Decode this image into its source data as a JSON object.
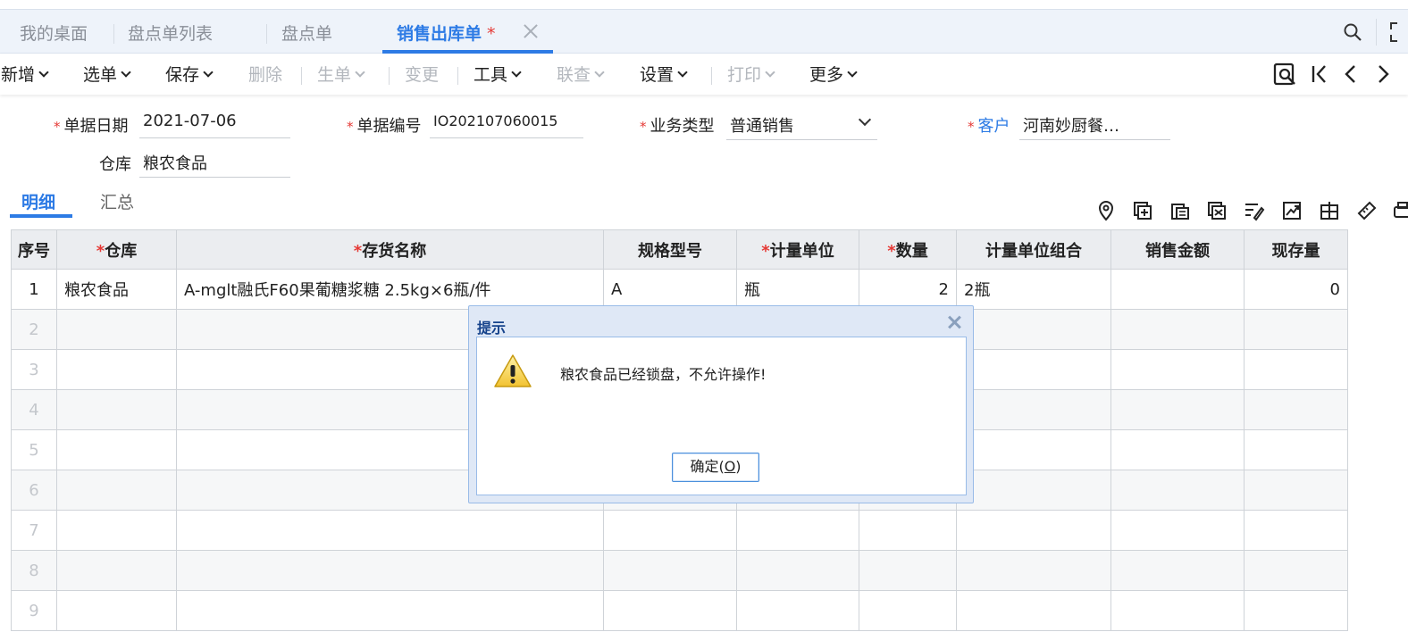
{
  "tabs": [
    {
      "label": "我的桌面"
    },
    {
      "label": "盘点单列表"
    },
    {
      "label": "盘点单"
    },
    {
      "label": "销售出库单",
      "modified_mark": "*"
    }
  ],
  "toolbar": {
    "new": "新增",
    "select": "选单",
    "save": "保存",
    "delete": "删除",
    "generate": "生单",
    "change": "变更",
    "tools": "工具",
    "link_query": "联查",
    "settings": "设置",
    "print": "打印",
    "more": "更多"
  },
  "form": {
    "date_label": "单据日期",
    "date_value": "2021-07-06",
    "code_label": "单据编号",
    "code_value": "IO202107060015",
    "biz_type_label": "业务类型",
    "biz_type_value": "普通销售",
    "customer_label": "客户",
    "customer_value": "河南妙厨餐…",
    "warehouse_label": "仓库",
    "warehouse_value": "粮农食品",
    "required_mark": "*"
  },
  "subtabs": {
    "detail": "明细",
    "summary": "汇总"
  },
  "grid": {
    "required_mark": "*",
    "headers": [
      "序号",
      "仓库",
      "存货名称",
      "规格型号",
      "计量单位",
      "数量",
      "计量单位组合",
      "销售金额",
      "现存量"
    ],
    "rows": [
      {
        "seq": "1",
        "warehouse": "粮农食品",
        "item": "A-mglt融氏F60果葡糖浆糖 2.5kg×6瓶/件",
        "spec": "A",
        "unit": "瓶",
        "qty": "2",
        "unit_combo": "2瓶",
        "amount": "",
        "stock": "0"
      },
      {
        "seq": "2"
      },
      {
        "seq": "3"
      },
      {
        "seq": "4"
      },
      {
        "seq": "5"
      },
      {
        "seq": "6"
      },
      {
        "seq": "7"
      },
      {
        "seq": "8"
      },
      {
        "seq": "9"
      }
    ]
  },
  "dialog": {
    "title": "提示",
    "message": "粮农食品已经锁盘，不允许操作!",
    "ok_label": "确定(",
    "ok_key": "O",
    "ok_suffix": ")"
  },
  "colors": {
    "accent": "#2d7be5",
    "required": "#e53935",
    "dialog_title": "#15428b"
  }
}
